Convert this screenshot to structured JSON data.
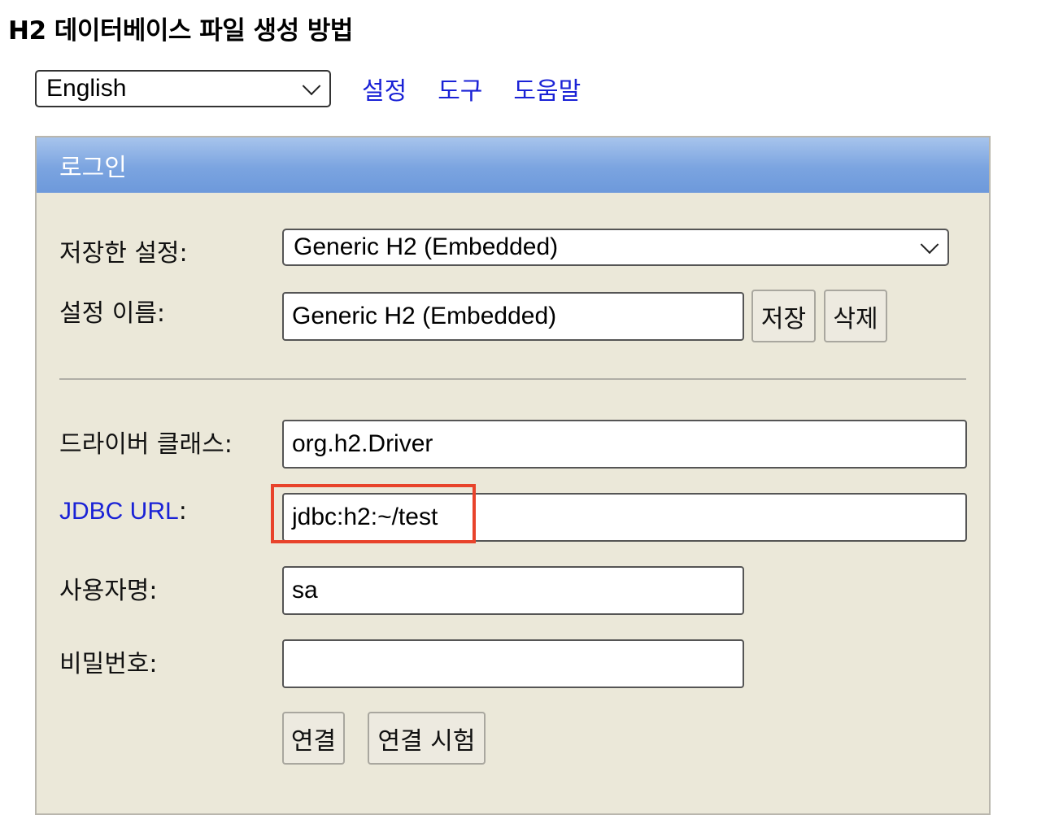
{
  "page": {
    "title": "H2 데이터베이스 파일 생성 방법"
  },
  "topbar": {
    "language": "English",
    "links": [
      "설정",
      "도구",
      "도움말"
    ]
  },
  "login": {
    "header": "로그인",
    "saved_settings_label": "저장한 설정:",
    "saved_settings_value": "Generic H2 (Embedded)",
    "setting_name_label": "설정 이름:",
    "setting_name_value": "Generic H2 (Embedded)",
    "save_button": "저장",
    "delete_button": "삭제",
    "driver_class_label": "드라이버 클래스:",
    "driver_class_value": "org.h2.Driver",
    "jdbc_url_link": "JDBC URL",
    "jdbc_url_colon": ":",
    "jdbc_url_value": "jdbc:h2:~/test",
    "username_label": "사용자명:",
    "username_value": "sa",
    "password_label": "비밀번호:",
    "password_value": "",
    "connect_button": "연결",
    "test_connection_button": "연결 시험"
  },
  "colors": {
    "link": "#1a22d6",
    "panel_bg": "#ebe8d9",
    "header_gradient_top": "#a7c4ec",
    "header_gradient_bottom": "#6d99db",
    "highlight_box": "#e8432b"
  },
  "icons": {
    "dropdown": "chevron-down-icon"
  }
}
